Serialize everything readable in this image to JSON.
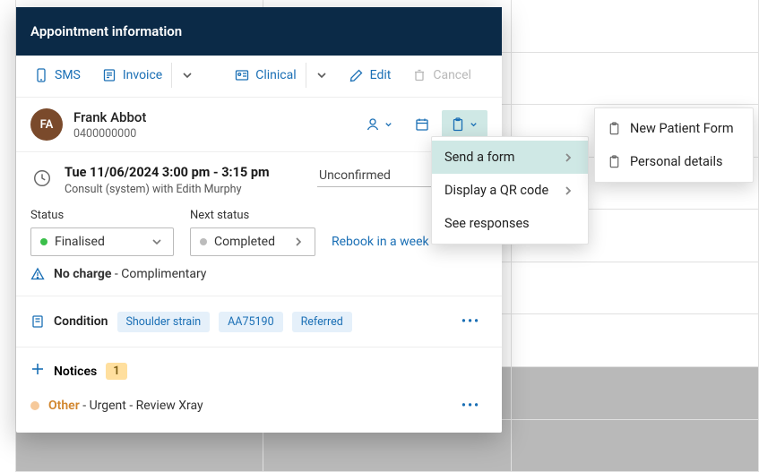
{
  "modal": {
    "title": "Appointment information"
  },
  "toolbar": {
    "sms_label": "SMS",
    "invoice_label": "Invoice",
    "clinical_label": "Clinical",
    "edit_label": "Edit",
    "cancel_label": "Cancel"
  },
  "patient": {
    "initials": "FA",
    "name": "Frank Abbot",
    "phone": "0400000000"
  },
  "appointment": {
    "datetime": "Tue 11/06/2024 3:00 pm - 3:15 pm",
    "subtitle": "Consult (system) with Edith Murphy",
    "confirmation_status": "Unconfirmed"
  },
  "status": {
    "label": "Status",
    "current": "Finalised",
    "next_label": "Next status",
    "next": "Completed",
    "rebook_label": "Rebook in a week"
  },
  "charge": {
    "prefix": "No charge",
    "detail": " - Complimentary"
  },
  "condition": {
    "label": "Condition",
    "tags": [
      "Shoulder strain",
      "AA75190",
      "Referred"
    ]
  },
  "notices": {
    "label": "Notices",
    "count": "1",
    "items": [
      {
        "category": "Other",
        "text": " - Urgent - Review Xray"
      }
    ]
  },
  "forms_menu": {
    "send": "Send a form",
    "qr": "Display a QR code",
    "responses": "See responses"
  },
  "forms_submenu": {
    "new_patient": "New Patient Form",
    "personal": "Personal details"
  }
}
